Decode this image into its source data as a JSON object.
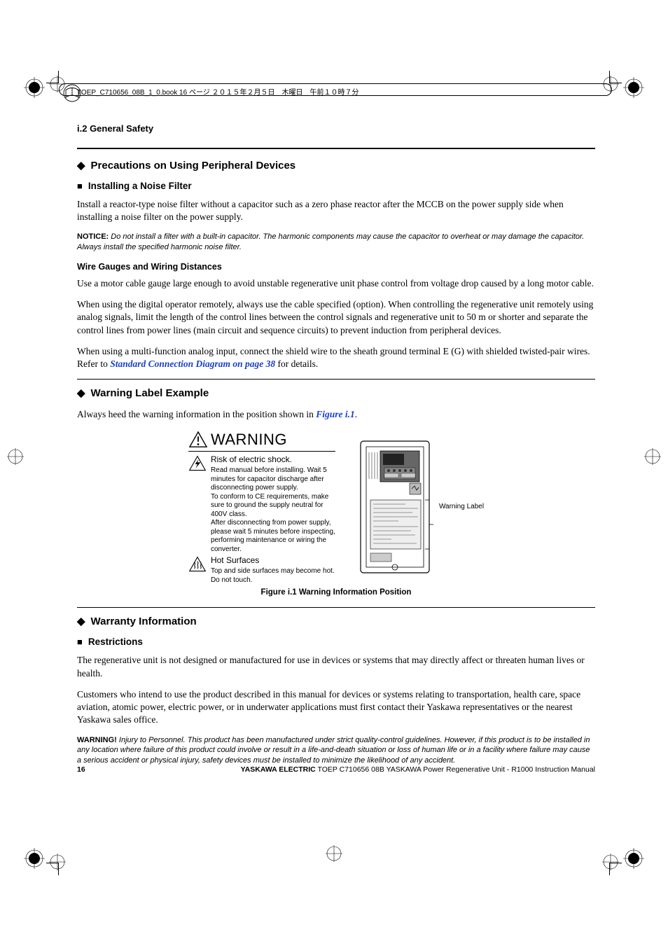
{
  "meta_header": "TOEP_C710656_08B_1_0.book  16 ページ  ２０１５年２月５日　木曜日　午前１０時７分",
  "running_head": "i.2  General Safety",
  "h_precautions": "Precautions on Using Peripheral Devices",
  "h_noise_filter": "Installing a Noise Filter",
  "p_noise_filter": "Install a reactor-type noise filter without a capacitor such as a zero phase reactor after the MCCB on the power supply side when installing a noise filter on the power supply.",
  "notice_label": "NOTICE:",
  "notice_body": "Do not install a filter with a built-in capacitor. The harmonic components may cause the capacitor to overheat or may damage the capacitor. Always install the specified harmonic noise filter.",
  "h_wire_gauges": "Wire Gauges and Wiring Distances",
  "p_wire_gauges_1": "Use a motor cable gauge large enough to avoid unstable regenerative unit phase control from voltage drop caused by a long motor cable.",
  "p_wire_gauges_2": "When using the digital operator remotely, always use the cable specified (option). When controlling the regenerative unit remotely using analog signals, limit the length of the control lines between the control signals and regenerative unit to 50 m or shorter and separate the control lines from power lines (main circuit and sequence circuits) to prevent induction from peripheral devices.",
  "p_wire_gauges_3a": "When using a multi-function analog input, connect the shield wire to the sheath ground terminal E (G) with shielded twisted-pair wires. Refer to ",
  "ref_link_1": "Standard Connection Diagram on page 38",
  "p_wire_gauges_3b": " for details.",
  "h_warning_label": "Warning Label Example",
  "p_warning_intro_a": "Always heed the warning information in the position shown in ",
  "ref_fig": "Figure i.1",
  "p_warning_intro_b": ".",
  "warning_word": "WARNING",
  "warn_shock_lead": "Risk of electric shock.",
  "warn_shock_body": "Read manual before installing. Wait 5 minutes for capacitor discharge after disconnecting power supply.\nTo conform to CE requirements, make sure to ground the supply neutral for 400V class.\nAfter disconnecting from power supply, please wait 5 minutes before inspecting, performing maintenance or wiring the converter.",
  "warn_hot_lead": "Hot Surfaces",
  "warn_hot_body": "Top and side surfaces may become hot. Do not touch.",
  "callout_label": "Warning Label",
  "fig_caption": "Figure i.1  Warning Information Position",
  "h_warranty": "Warranty Information",
  "h_restrictions": "Restrictions",
  "p_restrict_1": "The regenerative unit is not designed or manufactured for use in devices or systems that may directly affect or threaten human lives or health.",
  "p_restrict_2": "Customers who intend to use the product described in this manual for devices or systems relating to transportation, health care, space aviation, atomic power, electric power, or in underwater applications must first contact their Yaskawa representatives or the nearest Yaskawa sales office.",
  "warning_label2": "WARNING!",
  "warning_body2": "Injury to Personnel. This product has been manufactured under strict quality-control guidelines. However, if this product is to be installed in any location where failure of this product could involve or result in a life-and-death situation or loss of human life or in a facility where failure may cause a serious accident or physical injury, safety devices must be installed to minimize the likelihood of any accident.",
  "page_number": "16",
  "footer_bold": "YASKAWA ELECTRIC",
  "footer_rest": " TOEP C710656 08B YASKAWA Power Regenerative Unit - R1000 Instruction Manual"
}
